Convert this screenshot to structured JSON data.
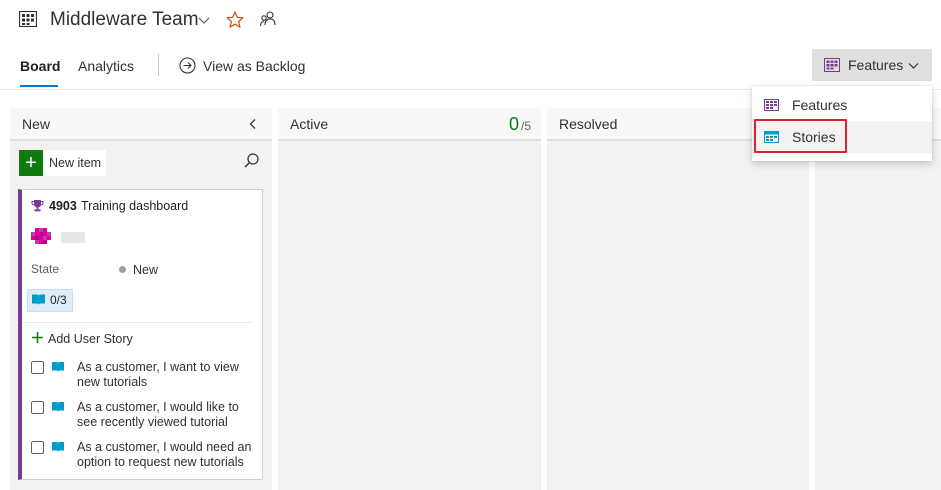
{
  "header": {
    "team_name": "Middleware Team",
    "icons": [
      "board-grid-icon",
      "chevron-down-icon",
      "star-icon",
      "people-icon"
    ]
  },
  "tabs": [
    {
      "label": "Board",
      "selected": true
    },
    {
      "label": "Analytics",
      "selected": false
    }
  ],
  "view_as_backlog": "View as Backlog",
  "backlog_level_button": {
    "label": "Features"
  },
  "dropdown": {
    "items": [
      {
        "label": "Features",
        "icon": "features-icon"
      },
      {
        "label": "Stories",
        "icon": "stories-icon",
        "highlighted": true
      }
    ]
  },
  "columns": [
    {
      "title": "New"
    },
    {
      "title": "Active",
      "wip_count": "0",
      "wip_limit": "/5"
    },
    {
      "title": "Resolved"
    }
  ],
  "new_item_label": "New item",
  "card": {
    "id": "4903",
    "title": "Training dashboard",
    "state_label": "State",
    "state_value": "New",
    "rollup": "0/3",
    "add_child_label": "Add User Story",
    "children": [
      {
        "text": "As a customer, I want to view new tutorials"
      },
      {
        "text": "As a customer, I would like to see recently viewed tutorial"
      },
      {
        "text": "As a customer, I would need an option to request new tutorials"
      }
    ]
  },
  "colors": {
    "accent": "#0078d4",
    "feature_purple": "#773b93",
    "story_blue": "#009ccc",
    "highlight_red": "#d9232a",
    "wip_green": "#107c10"
  }
}
